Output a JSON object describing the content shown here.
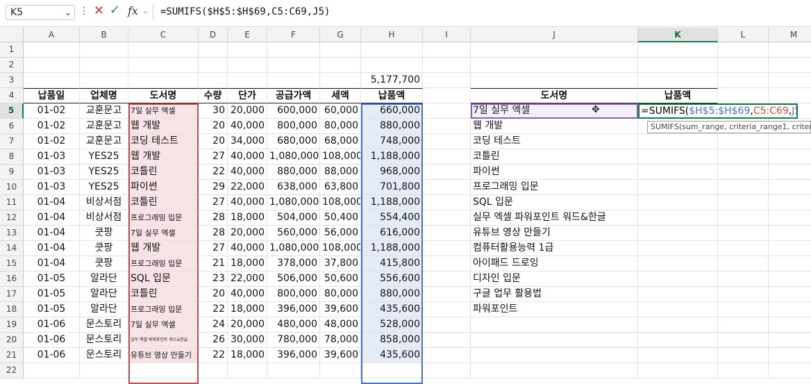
{
  "formula_bar": {
    "name_box": "K5",
    "chevron": "⌄",
    "dots": "⋮",
    "cancel": "✕",
    "enter": "✓",
    "fx": "fx",
    "formula": "=SUMIFS($H$5:$H$69,C5:C69,J5)"
  },
  "columns": [
    "A",
    "B",
    "C",
    "D",
    "E",
    "F",
    "G",
    "H",
    "I",
    "J",
    "K",
    "L",
    "M"
  ],
  "total_H3": "5,177,700",
  "headers": {
    "A": "납품일",
    "B": "업체명",
    "C": "도서명",
    "D": "수량",
    "E": "단가",
    "F": "공급가액",
    "G": "세액",
    "H": "납품액",
    "J": "도서명",
    "K": "납품액"
  },
  "rows": [
    [
      "01-02",
      "교훈문고",
      "7일 실무 엑셀",
      "30",
      "20,000",
      "600,000",
      "60,000",
      "660,000"
    ],
    [
      "01-02",
      "교훈문고",
      "웹 개발",
      "20",
      "40,000",
      "800,000",
      "80,000",
      "880,000"
    ],
    [
      "01-02",
      "교훈문고",
      "코딩 테스트",
      "20",
      "34,000",
      "680,000",
      "68,000",
      "748,000"
    ],
    [
      "01-03",
      "YES25",
      "웹 개발",
      "27",
      "40,000",
      "1,080,000",
      "108,000",
      "1,188,000"
    ],
    [
      "01-03",
      "YES25",
      "코틀린",
      "22",
      "40,000",
      "880,000",
      "88,000",
      "968,000"
    ],
    [
      "01-03",
      "YES25",
      "파이썬",
      "29",
      "22,000",
      "638,000",
      "63,800",
      "701,800"
    ],
    [
      "01-04",
      "비상서점",
      "코틀린",
      "27",
      "40,000",
      "1,080,000",
      "108,000",
      "1,188,000"
    ],
    [
      "01-04",
      "비상서점",
      "프로그래밍 입문",
      "28",
      "18,000",
      "504,000",
      "50,400",
      "554,400"
    ],
    [
      "01-04",
      "쿳팡",
      "7일 실무 엑셀",
      "28",
      "20,000",
      "560,000",
      "56,000",
      "616,000"
    ],
    [
      "01-04",
      "쿳팡",
      "웹 개발",
      "27",
      "40,000",
      "1,080,000",
      "108,000",
      "1,188,000"
    ],
    [
      "01-04",
      "쿳팡",
      "프로그래밍 입문",
      "21",
      "18,000",
      "378,000",
      "37,800",
      "415,800"
    ],
    [
      "01-05",
      "알라단",
      "SQL 입문",
      "23",
      "22,000",
      "506,000",
      "50,600",
      "556,600"
    ],
    [
      "01-05",
      "알라단",
      "코틀린",
      "20",
      "40,000",
      "800,000",
      "80,000",
      "880,000"
    ],
    [
      "01-05",
      "알라단",
      "프로그래밍 입문",
      "22",
      "18,000",
      "396,000",
      "39,600",
      "435,600"
    ],
    [
      "01-06",
      "문스토리",
      "7일 실무 엑셀",
      "24",
      "20,000",
      "480,000",
      "48,000",
      "528,000"
    ],
    [
      "01-06",
      "문스토리",
      "실무 엑셀 파워포인트 워드&한글",
      "26",
      "30,000",
      "780,000",
      "78,000",
      "858,000"
    ],
    [
      "01-06",
      "문스토리",
      "유튜브 영상 만들기",
      "22",
      "18,000",
      "396,000",
      "39,600",
      "435,600"
    ]
  ],
  "book_list": [
    "7일 실무 엑셀",
    "웹 개발",
    "코딩 테스트",
    "코틀린",
    "파이썬",
    "프로그래밍 입문",
    "SQL 입문",
    "실무 엑셀 파워포인트 워드&한글",
    "유튜브 영상 만들기",
    "컴퓨터활용능력 1급",
    "아이패드 드로잉",
    "디자인 입문",
    "구글 업무 활용법",
    "파워포인트"
  ],
  "edit": {
    "prefix": "=SUMIFS(",
    "ref_h": "$H$5:$H$69",
    "comma1": ",",
    "ref_c": "C5:C69",
    "comma2": ",",
    "ref_j": "J5",
    "suffix": ")"
  },
  "tooltip": "SUMIFS(sum_range, criteria_range1, criteri",
  "cursor_glyph": "✥",
  "colors": {
    "accent": "#107c41",
    "range_C": "#c0504d",
    "range_H": "#4472c4",
    "range_J": "#8e5fb8"
  }
}
